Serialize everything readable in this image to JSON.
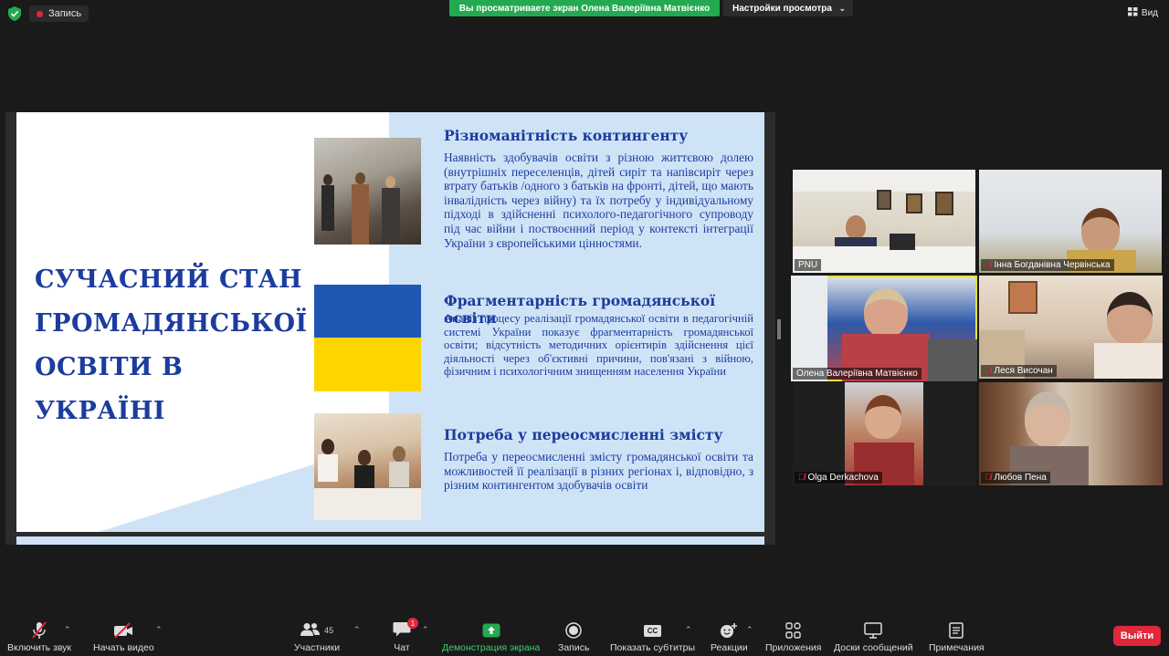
{
  "top": {
    "record_label": "Запись",
    "share_banner": "Вы просматриваете экран Олена Валеріївна Матвієнко",
    "view_options": "Настройки просмотра",
    "view_label": "Вид"
  },
  "slide": {
    "title_lines": [
      "СУЧАСНИЙ СТАН",
      "ГРОМАДЯНСЬКОЇ",
      "ОСВІТИ В УКРАЇНІ"
    ],
    "sections": [
      {
        "heading": "Різноманітність контингенту",
        "body": "Наявність здобувачів освіти з різною життєвою долею (внутрішніх переселенців, дітей сиріт та напівсиріт через втрату батьків /одного з батьків на фронті, дітей, що мають інвалідність через війну) та їх потребу у індивідуальному підході в здійсненні психолого-педагогічного супроводу під час війни і поствоєнний період у контексті інтеграції України з європейськими цінностями."
      },
      {
        "heading": "Фрагментарність громадянської освіти",
        "body": "Аналіз процесу реалізації громадянської освіти в педагогічній системі України показує фрагментарність громадянської освіти; відсутність методичних орієнтирів здійснення цієї діяльності через об'єктивні причини, пов'язані з війною, фізичним і психологічним знищенням населення України"
      },
      {
        "heading": "Потреба у переосмисленні змісту",
        "body": "Потреба у переосмисленні змісту громадянської освіти та можливостей її реалізації в різних регіонах і, відповідно, з різним контингентом здобувачів освіти"
      }
    ]
  },
  "participants": [
    {
      "name": "PNU",
      "muted": false
    },
    {
      "name": "Інна Богданівна Червінська",
      "muted": true
    },
    {
      "name": "Олена Валеріївна Матвієнко",
      "muted": false,
      "active_speaker": true
    },
    {
      "name": "Леся Височан",
      "muted": true
    },
    {
      "name": "Olga Derkachova",
      "muted": true
    },
    {
      "name": "Любов Пена",
      "muted": true
    }
  ],
  "toolbar": {
    "audio": "Включить звук",
    "video": "Начать видео",
    "participants": "Участники",
    "participants_count": "45",
    "chat": "Чат",
    "chat_badge": "1",
    "share": "Демонстрация экрана",
    "record": "Запись",
    "captions": "Показать субтитры",
    "captions_icon": "CC",
    "reactions": "Реакции",
    "apps": "Приложения",
    "whiteboards": "Доски сообщений",
    "notes": "Примечания",
    "leave": "Выйти"
  },
  "colors": {
    "accent_green": "#23a94f",
    "leave_red": "#e0283a",
    "slide_blue": "#1c3c9e",
    "active_speaker": "#e6e23a"
  }
}
